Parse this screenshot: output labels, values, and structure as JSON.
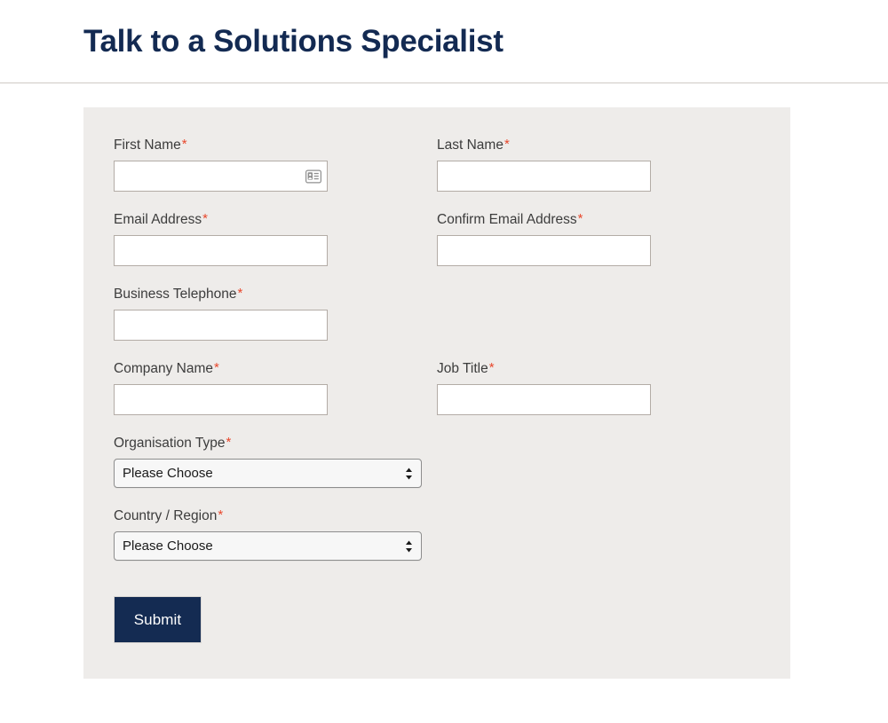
{
  "header": {
    "title": "Talk to a Solutions Specialist"
  },
  "colors": {
    "title_navy": "#132a52",
    "submit_navy": "#142b52",
    "panel_background": "#eeecea",
    "required_star": "#e8472c",
    "input_border": "#b3aca6",
    "label_text": "#3c3c3c"
  },
  "form": {
    "required_marker": "*",
    "rows": [
      {
        "left": {
          "label": "First Name",
          "required": true,
          "type": "text",
          "value": "",
          "placeholder": "",
          "icon": "contact-card-autofill-icon"
        },
        "right": {
          "label": "Last Name",
          "required": true,
          "type": "text",
          "value": "",
          "placeholder": ""
        }
      },
      {
        "left": {
          "label": "Email Address",
          "required": true,
          "type": "text",
          "value": "",
          "placeholder": ""
        },
        "right": {
          "label": "Confirm Email Address",
          "required": true,
          "type": "text",
          "value": "",
          "placeholder": ""
        }
      },
      {
        "left": {
          "label": "Business Telephone",
          "required": true,
          "type": "text",
          "value": "",
          "placeholder": ""
        },
        "right": null
      },
      {
        "left": {
          "label": "Company Name",
          "required": true,
          "type": "text",
          "value": "",
          "placeholder": ""
        },
        "right": {
          "label": "Job Title",
          "required": true,
          "type": "text",
          "value": "",
          "placeholder": ""
        }
      },
      {
        "left": {
          "label": "Organisation Type",
          "required": true,
          "type": "select",
          "value": "Please Choose"
        },
        "right": null
      },
      {
        "left": {
          "label": "Country / Region",
          "required": true,
          "type": "select",
          "value": "Please Choose"
        },
        "right": null
      }
    ],
    "submit_label": "Submit"
  }
}
